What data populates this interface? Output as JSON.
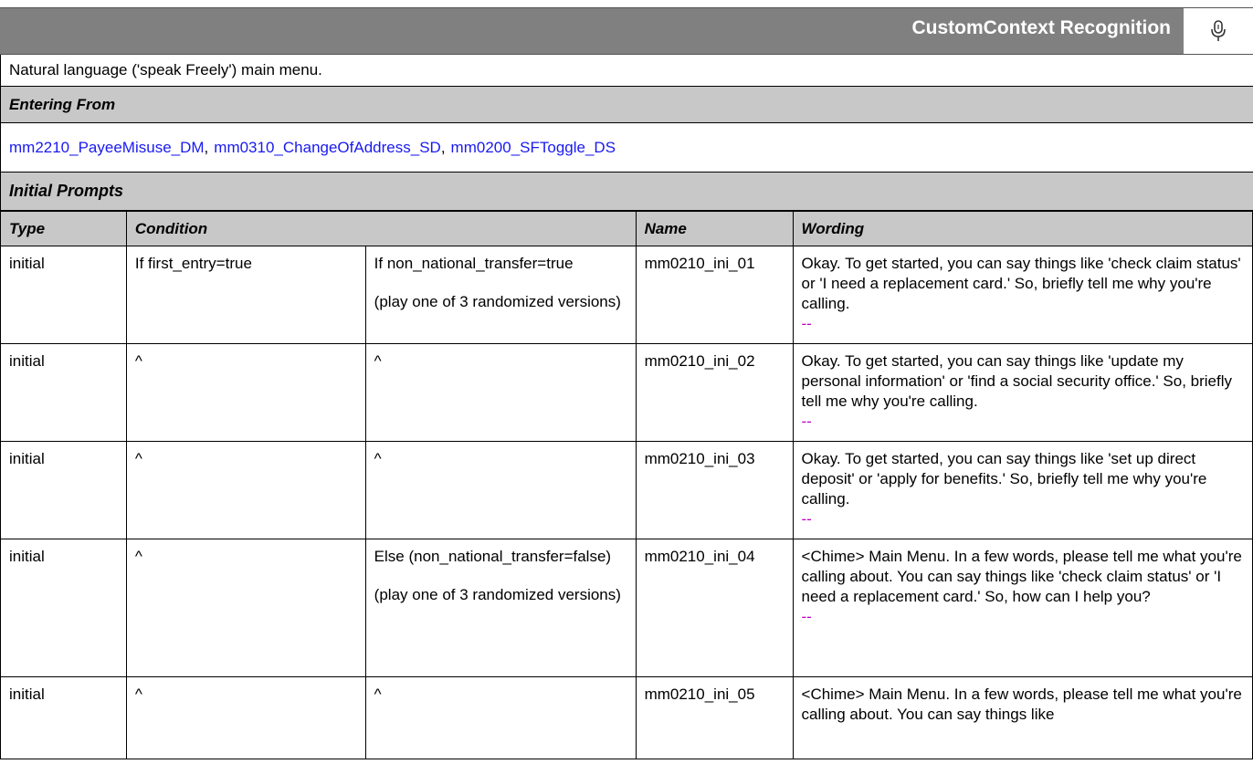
{
  "header": {
    "title": "CustomContext Recognition",
    "icon": "microphone-icon"
  },
  "description": "Natural language ('speak Freely') main menu.",
  "entering_from": {
    "label": "Entering From",
    "links": [
      "mm2210_PayeeMisuse_DM",
      "mm0310_ChangeOfAddress_SD",
      "mm0200_SFToggle_DS"
    ],
    "separator": ","
  },
  "initial_prompts": {
    "section_label": "Initial Prompts",
    "columns": {
      "type": "Type",
      "condition": "Condition",
      "name": "Name",
      "wording": "Wording"
    },
    "rows": [
      {
        "type": "initial",
        "cond1": "If first_entry=true",
        "cond2": "If non_national_transfer=true",
        "cond2_sub": "(play one of 3 randomized versions)",
        "name": "mm0210_ini_01",
        "wording": "Okay.  To get started, you can say things like 'check claim status' or 'I need a replacement card.' So, briefly tell me why you're calling.",
        "dash": "--"
      },
      {
        "type": "initial",
        "cond1": "^",
        "cond2": "^",
        "cond2_sub": "",
        "name": "mm0210_ini_02",
        "wording": "Okay.  To get started, you can say things like 'update my personal information' or 'find a social security office.' So, briefly tell me why you're calling.",
        "dash": "--"
      },
      {
        "type": "initial",
        "cond1": "^",
        "cond2": "^",
        "cond2_sub": "",
        "name": "mm0210_ini_03",
        "wording": "Okay.  To get started, you can say things like 'set up direct deposit' or 'apply for benefits.'  So, briefly tell me why you're calling.",
        "dash": "--"
      },
      {
        "type": "initial",
        "cond1": "^",
        "cond2": "Else (non_national_transfer=false)",
        "cond2_sub": "(play one of 3 randomized versions)",
        "name": "mm0210_ini_04",
        "wording": "<Chime> Main Menu. In a few words, please tell me what you're calling about. You can say things like 'check claim status' or 'I need a replacement card.' So, how can I help you?",
        "dash": "--"
      },
      {
        "type": "initial",
        "cond1": "^",
        "cond2": "^",
        "cond2_sub": "",
        "name": "mm0210_ini_05",
        "wording": "<Chime> Main Menu. In a few words, please tell me what you're calling about. You can say things like",
        "dash": ""
      }
    ]
  }
}
